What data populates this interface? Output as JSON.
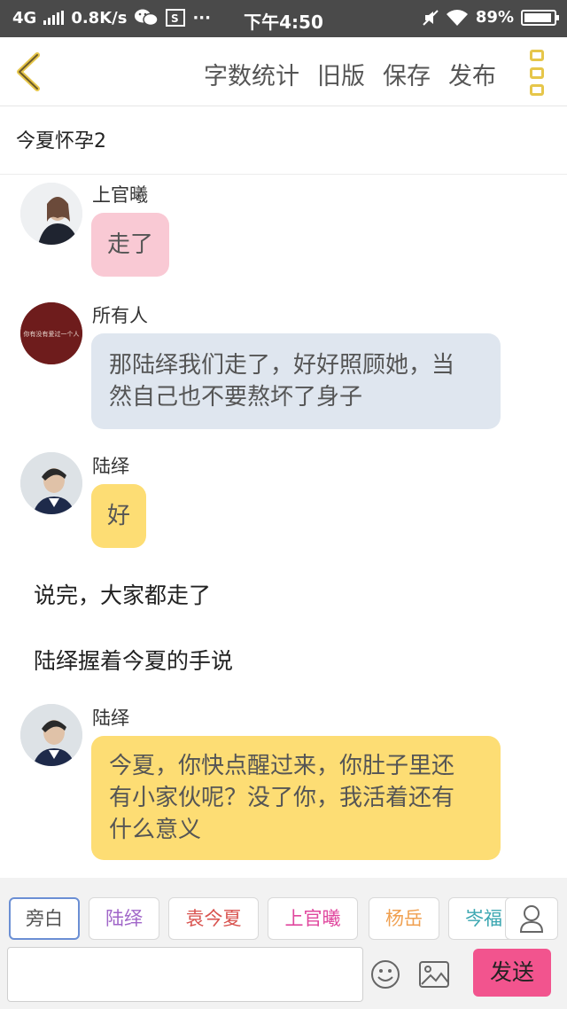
{
  "status_bar": {
    "network": "4G",
    "speed": "0.8K/s",
    "time": "下午4:50",
    "battery": "89%"
  },
  "top_bar": {
    "actions": [
      "字数统计",
      "旧版",
      "保存",
      "发布"
    ]
  },
  "title": "今夏怀孕2",
  "messages": [
    {
      "name": "上官曦",
      "text": "走了",
      "bubble_color": "#f9c9d4"
    },
    {
      "name": "所有人",
      "text_line1": "那陆绎我们走了，好好照顾她，当",
      "text_line2": "然自己也不要熬坏了身子",
      "avatar_caption": "你有没有爱过一个人",
      "bubble_color": "#dfe6ef"
    },
    {
      "name": "陆绎",
      "text": "好",
      "bubble_color": "#fddd74"
    },
    {
      "name": "陆绎",
      "text_line1": "今夏，你快点醒过来，你肚子里还",
      "text_line2": "有小家伙呢？没了你，我活着还有",
      "text_line3": "什么意义",
      "bubble_color": "#fddd74"
    }
  ],
  "narration": [
    "说完，大家都走了",
    "陆绎握着今夏的手说"
  ],
  "roles": [
    {
      "label": "旁白",
      "color": "#555555"
    },
    {
      "label": "陆绎",
      "color": "#a066c8"
    },
    {
      "label": "袁今夏",
      "color": "#d9534f"
    },
    {
      "label": "上官曦",
      "color": "#e0479e"
    },
    {
      "label": "杨岳",
      "color": "#f0a050"
    },
    {
      "label": "岑福",
      "color": "#3aa6b0"
    }
  ],
  "input": {
    "value": "",
    "send_label": "发送"
  },
  "icons": [
    "back-icon",
    "more-icon",
    "emoji-icon",
    "image-icon",
    "user-icon"
  ]
}
